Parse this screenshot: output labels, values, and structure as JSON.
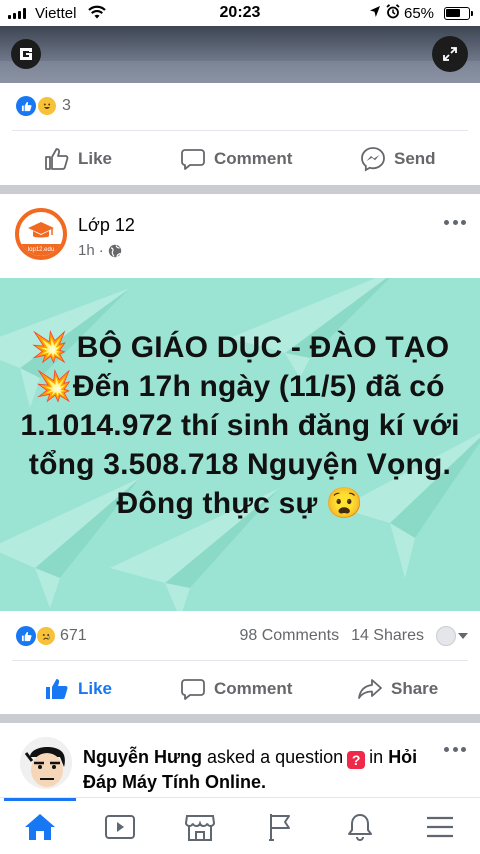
{
  "status_bar": {
    "carrier": "Viettel",
    "time": "20:23",
    "battery": "65%",
    "battery_level": 0.65
  },
  "post1": {
    "reactions_count": "3",
    "actions": {
      "like": "Like",
      "comment": "Comment",
      "send": "Send"
    }
  },
  "post2": {
    "author": "Lớp 12",
    "time": "1h",
    "avatar_caption": "lop12.edu",
    "banner_text": "💥 BỘ GIÁO DỤC - ĐÀO TẠO 💥Đến 17h ngày (11/5) đã có 1.1014.972 thí sinh đăng kí với tổng 3.508.718 Nguyện Vọng. Đông thực sự 😧",
    "reactions_count": "671",
    "comments": "98 Comments",
    "shares": "14 Shares",
    "actions": {
      "like": "Like",
      "comment": "Comment",
      "share": "Share"
    }
  },
  "post3": {
    "author": "Nguyễn Hưng",
    "verb": "asked a question",
    "in_word": "in",
    "group": "Hỏi Đáp Máy Tính Online."
  },
  "icons": {
    "post1": [
      "g-logo-icon",
      "expand-icon",
      "like-reaction-icon",
      "haha-reaction-icon",
      "like-icon",
      "comment-icon",
      "messenger-icon"
    ],
    "post2": [
      "more-icon",
      "globe-icon",
      "like-reaction-icon",
      "sad-reaction-icon",
      "chevron-down-icon",
      "like-icon",
      "comment-icon",
      "share-icon"
    ],
    "nav": [
      "home-icon",
      "watch-icon",
      "marketplace-icon",
      "pages-icon",
      "bell-icon",
      "menu-icon"
    ]
  },
  "colors": {
    "brand": "#1877f2",
    "banner_bg": "#9be4d4",
    "avatar_ring": "#f16a22"
  }
}
